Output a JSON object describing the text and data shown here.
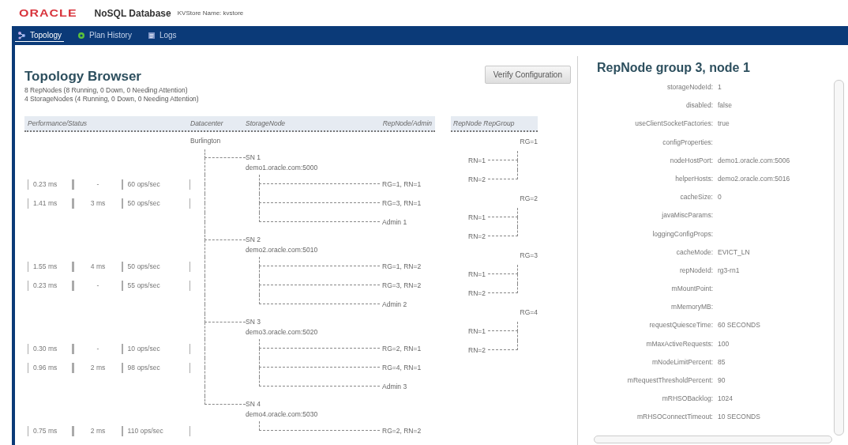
{
  "app": {
    "logo": "ORACLE",
    "product": "NoSQL Database",
    "store_label": "KVStore Name: kvstore"
  },
  "nav_tabs": [
    {
      "label": "Topology",
      "selected": true
    },
    {
      "label": "Plan History",
      "selected": false
    },
    {
      "label": "Logs",
      "selected": false
    }
  ],
  "topology_browser": {
    "title": "Topology Browser",
    "summary": [
      "8 RepNodes (8 Running, 0 Down, 0 Needing Attention)",
      "4 StorageNodes (4 Running, 0 Down, 0 Needing Attention)"
    ],
    "verify_button": "Verify Configuration"
  },
  "tree": {
    "columns": [
      "Performance/Status",
      "Datacenter",
      "StorageNode",
      "RepNode/Admin"
    ],
    "datacenter": "Burlington",
    "storage_nodes": [
      {
        "name": "SN 1",
        "host": "demo1.oracle.com:5000",
        "children": [
          {
            "kind": "repnode",
            "label": "RG=1, RN=1",
            "latency": "0.23 ms",
            "max_latency": "-",
            "throughput": "60 ops/sec"
          },
          {
            "kind": "repnode",
            "label": "RG=3, RN=1",
            "latency": "1.41 ms",
            "max_latency": "3 ms",
            "throughput": "50 ops/sec"
          },
          {
            "kind": "admin",
            "label": "Admin 1"
          }
        ]
      },
      {
        "name": "SN 2",
        "host": "demo2.oracle.com:5010",
        "children": [
          {
            "kind": "repnode",
            "label": "RG=1, RN=2",
            "latency": "1.55 ms",
            "max_latency": "4 ms",
            "throughput": "50 ops/sec"
          },
          {
            "kind": "repnode",
            "label": "RG=3, RN=2",
            "latency": "0.23 ms",
            "max_latency": "-",
            "throughput": "55 ops/sec"
          },
          {
            "kind": "admin",
            "label": "Admin 2"
          }
        ]
      },
      {
        "name": "SN 3",
        "host": "demo3.oracle.com:5020",
        "children": [
          {
            "kind": "repnode",
            "label": "RG=2, RN=1",
            "latency": "0.30 ms",
            "max_latency": "-",
            "throughput": "10 ops/sec"
          },
          {
            "kind": "repnode",
            "label": "RG=4, RN=1",
            "latency": "0.96 ms",
            "max_latency": "2 ms",
            "throughput": "98 ops/sec"
          },
          {
            "kind": "admin",
            "label": "Admin 3"
          }
        ]
      },
      {
        "name": "SN 4",
        "host": "demo4.oracle.com:5030",
        "children": [
          {
            "kind": "repnode",
            "label": "RG=2, RN=2",
            "latency": "0.75 ms",
            "max_latency": "2 ms",
            "throughput": "110 ops/sec"
          }
        ]
      }
    ]
  },
  "rep_groups": {
    "column": "RepNode RepGroup",
    "groups": [
      {
        "name": "RG=1",
        "nodes": [
          "RN=1",
          "RN=2"
        ]
      },
      {
        "name": "RG=2",
        "nodes": [
          "RN=1",
          "RN=2"
        ]
      },
      {
        "name": "RG=3",
        "nodes": [
          "RN=1",
          "RN=2"
        ]
      },
      {
        "name": "RG=4",
        "nodes": [
          "RN=1",
          "RN=2"
        ]
      }
    ]
  },
  "details": {
    "title": "RepNode group 3, node 1",
    "properties": [
      {
        "name": "storageNodeId:",
        "value": "1"
      },
      {
        "name": "disabled:",
        "value": "false"
      },
      {
        "name": "useClientSocketFactories:",
        "value": "true"
      },
      {
        "name": "configProperties:"
      },
      {
        "name": "nodeHostPort:",
        "value": "demo1.oracle.com:5006"
      },
      {
        "name": "helperHosts:",
        "value": "demo2.oracle.com:5016"
      },
      {
        "name": "cacheSize:",
        "value": "0"
      },
      {
        "name": "javaMiscParams:"
      },
      {
        "name": "loggingConfigProps:"
      },
      {
        "name": "cacheMode:",
        "value": "EVICT_LN"
      },
      {
        "name": "repNodeId:",
        "value": "rg3-rn1"
      },
      {
        "name": "mMountPoint:"
      },
      {
        "name": "mMemoryMB:"
      },
      {
        "name": "requestQuiesceTime:",
        "value": "60 SECONDS"
      },
      {
        "name": "mMaxActiveRequests:",
        "value": "100"
      },
      {
        "name": "mNodeLimitPercent:",
        "value": "85"
      },
      {
        "name": "mRequestThresholdPercent:",
        "value": "90"
      },
      {
        "name": "mRHSOBacklog:",
        "value": "1024"
      },
      {
        "name": "mRHSOConnectTimeout:",
        "value": "10 SECONDS"
      }
    ]
  }
}
